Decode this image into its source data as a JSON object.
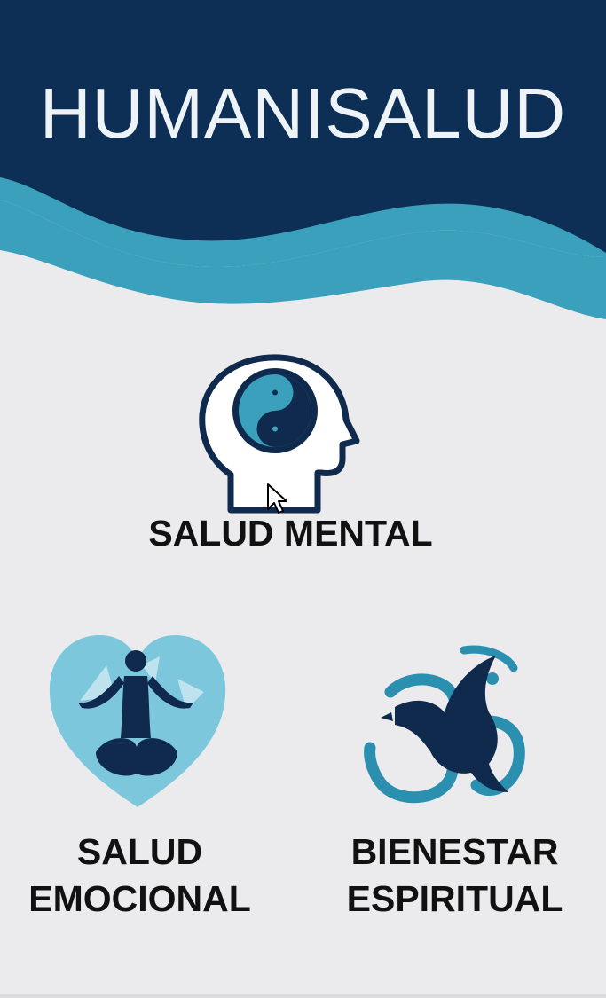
{
  "app": {
    "title": "HUMANISALUD"
  },
  "colors": {
    "header_dark": "#0d2f55",
    "wave_teal": "#3aa0bb",
    "background": "#ebebed",
    "icon_dark": "#0f2a4d",
    "icon_light": "#7cc7dc"
  },
  "tiles": [
    {
      "id": "salud-mental",
      "lines": [
        "SALUD MENTAL"
      ],
      "icon": "head-yin-yang-icon"
    },
    {
      "id": "salud-emocional",
      "lines": [
        "SALUD",
        "EMOCIONAL"
      ],
      "icon": "heart-meditation-icon"
    },
    {
      "id": "bienestar-espiritual",
      "lines": [
        "BIENESTAR",
        "ESPIRITUAL"
      ],
      "icon": "om-dove-icon"
    }
  ]
}
